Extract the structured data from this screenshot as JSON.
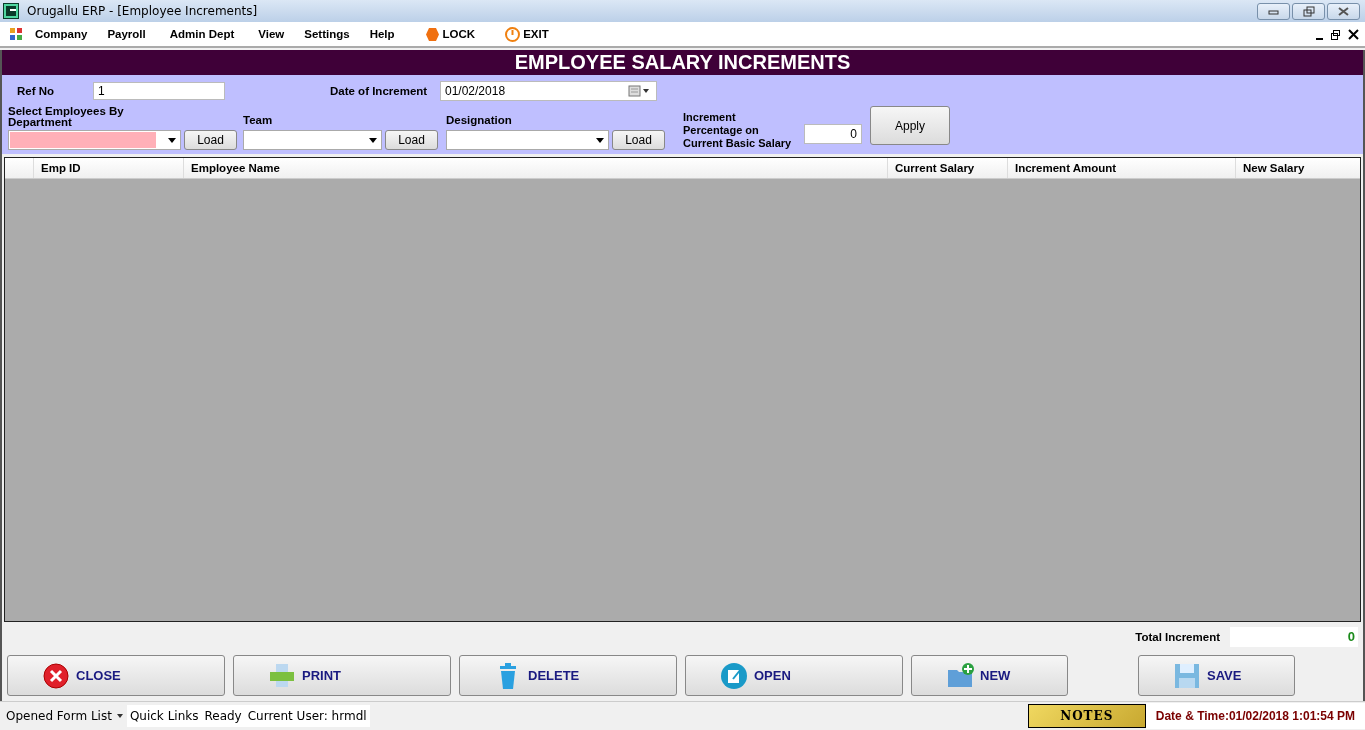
{
  "window": {
    "title": "Orugallu ERP - [Employee Increments]"
  },
  "menu": [
    {
      "label": "Company",
      "kind": "menu"
    },
    {
      "label": "Payroll",
      "kind": "menu"
    },
    {
      "label": "Admin Dept",
      "kind": "menu"
    },
    {
      "label": "View",
      "kind": "menu"
    },
    {
      "label": "Settings",
      "kind": "menu"
    },
    {
      "label": "Help",
      "kind": "menu"
    },
    {
      "label": "LOCK",
      "kind": "lock"
    },
    {
      "label": "EXIT",
      "kind": "exit"
    }
  ],
  "form_title": "EMPLOYEE SALARY INCREMENTS",
  "ref_no": {
    "label": "Ref No",
    "value": "1"
  },
  "date_of_increment": {
    "label": "Date of Increment",
    "value": "01/02/2018"
  },
  "filters": [
    {
      "label": "Select Employees By Department",
      "highlighted": true,
      "button": "Load"
    },
    {
      "label": "Team",
      "highlighted": false,
      "button": "Load"
    },
    {
      "label": "Designation",
      "highlighted": false,
      "button": "Load"
    }
  ],
  "increment": {
    "label": "Increment Percentage on Current Basic Salary",
    "value": "0",
    "button": "Apply"
  },
  "table": {
    "columns": [
      "Emp ID",
      "Employee Name",
      "Current Salary",
      "Increment Amount",
      "New Salary"
    ]
  },
  "total_increment": {
    "label": "Total Increment",
    "value": "0"
  },
  "buttons": [
    {
      "label": "CLOSE",
      "kind": "close"
    },
    {
      "label": "PRINT",
      "kind": "print"
    },
    {
      "label": "DELETE",
      "kind": "delete"
    },
    {
      "label": "OPEN",
      "kind": "open"
    },
    {
      "label": "NEW",
      "kind": "new"
    },
    {
      "label": "SAVE",
      "kind": "save"
    }
  ],
  "status_bar": {
    "opened_form_list": "Opened Form List",
    "quick_links": "Quick Links",
    "status": "Ready",
    "user": "Current User: hrmdl",
    "notes": "NOTES",
    "datetime": "Date & Time:01/02/2018 1:01:54 PM"
  }
}
